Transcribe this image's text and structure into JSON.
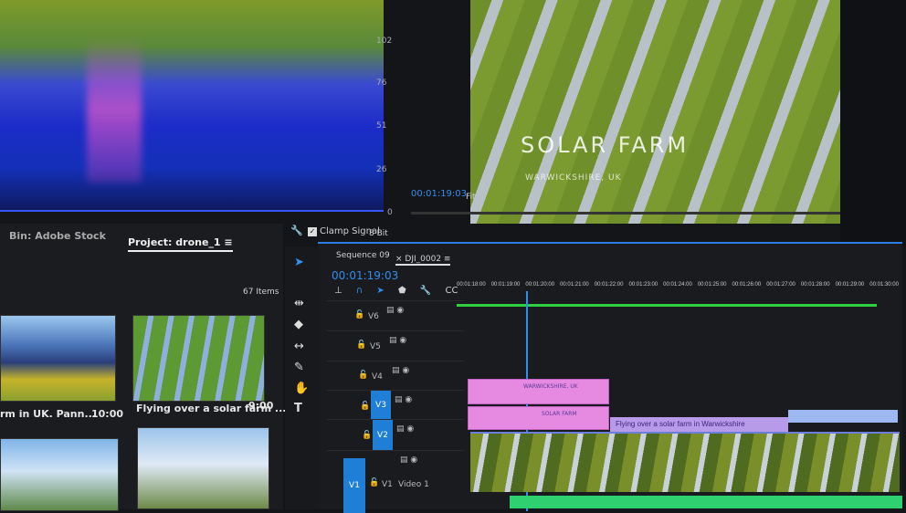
{
  "scope": {
    "scale": [
      "102",
      "76",
      "51",
      "26",
      "0"
    ],
    "clamp_label": "Clamp Signal",
    "clamp_checked": true,
    "bit_depth": "8 Bit"
  },
  "program": {
    "title_overlay": "SOLAR FARM",
    "subtitle_overlay": "WARWICKSHIRE, UK",
    "timecode": "00:01:19:03",
    "zoom": "Fit"
  },
  "project": {
    "bin_tab": "Bin: Adobe Stock",
    "project_tab": "Project: drone_1",
    "items_count": "67 Items",
    "clips": [
      {
        "name": "rm in UK. Pann...",
        "duration": "10:00"
      },
      {
        "name": "Flying over a solar farm ...",
        "duration": "9:00"
      }
    ]
  },
  "timeline": {
    "sequence_tab": "Sequence 09",
    "clip_tab": "DJI_0002",
    "timecode": "00:01:19:03",
    "ruler": [
      "00:01:18:00",
      "00:01:19:00",
      "00:01:20:00",
      "00:01:21:00",
      "00:01:22:00",
      "00:01:23:00",
      "00:01:24:00",
      "00:01:25:00",
      "00:01:26:00",
      "00:01:27:00",
      "00:01:28:00",
      "00:01:29:00",
      "00:01:30:00"
    ],
    "tracks": [
      {
        "name": "V6"
      },
      {
        "name": "V5"
      },
      {
        "name": "V4"
      },
      {
        "name": "V3",
        "target": "V3"
      },
      {
        "name": "V2",
        "target": "V2"
      },
      {
        "name": "V1",
        "target": "V1",
        "label": "Video 1"
      }
    ],
    "graphics": [
      "WARWICKSHIRE, UK",
      "SOLAR FARM"
    ],
    "title_clip": "Flying over a solar farm in Warwickshire"
  },
  "colors": {
    "accent": "#2f8ff0",
    "graphic_clip": "#e58ae0",
    "audio_bar": "#2fd070"
  }
}
